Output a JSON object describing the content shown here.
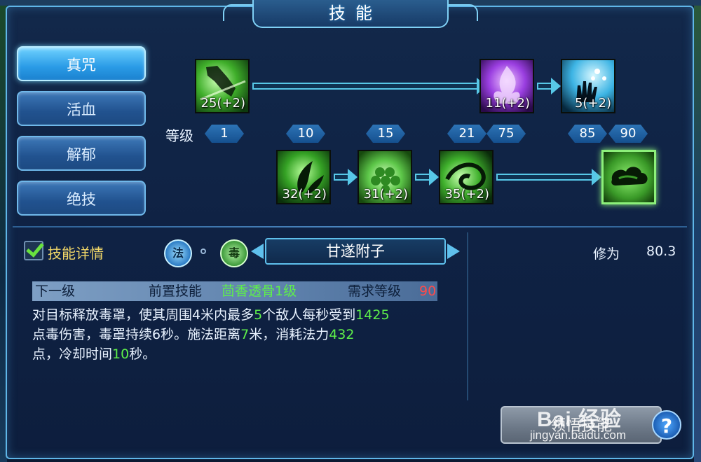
{
  "window": {
    "title": "技能"
  },
  "tabs": [
    {
      "label": "真咒",
      "active": true
    },
    {
      "label": "活血",
      "active": false
    },
    {
      "label": "解郁",
      "active": false
    },
    {
      "label": "绝技",
      "active": false
    }
  ],
  "tree": {
    "level_label": "等级",
    "levels": [
      "1",
      "10",
      "15",
      "21",
      "75",
      "85",
      "90"
    ],
    "nodes": [
      {
        "icon": "green-hand-skill-icon",
        "count": "25(+2)"
      },
      {
        "icon": "purple-flame-skill-icon",
        "count": "11(+2)"
      },
      {
        "icon": "cyan-hand-skill-icon",
        "count": "5(+2)"
      },
      {
        "icon": "green-leaf-skill-icon",
        "count": "32(+2)"
      },
      {
        "icon": "green-orbs-skill-icon",
        "count": "31(+2)"
      },
      {
        "icon": "green-swirl-skill-icon",
        "count": "35(+2)"
      },
      {
        "icon": "poison-cloud-skill-icon",
        "count": ""
      }
    ]
  },
  "detail": {
    "toggle_label": "技能详情",
    "checked": true,
    "school_badge": "法",
    "element_badge": "毒",
    "skill_name": "甘遂附子",
    "cultivation_label": "修为",
    "cultivation_value": "80.3",
    "requirements": {
      "next_label": "下一级",
      "prereq_label": "前置技能",
      "prereq_skill": "茴香透骨1级",
      "level_label": "需求等级",
      "level_value": "90"
    },
    "description": {
      "p1": "对目标释放毒罩，使其周围4米内最多",
      "v1": "5",
      "p2": "个敌人每秒受到",
      "v2": "1425",
      "p3": "点毒伤害，毒罩持续6秒。施法距离",
      "v3": "7",
      "p4": "米，消耗法力",
      "v4": "432",
      "p5": "点，冷却时间",
      "v5": "10",
      "p6": "秒。"
    }
  },
  "actions": {
    "learn_label": "领悟技能",
    "help_label": "?"
  },
  "watermark": {
    "brand": "Bai 经验",
    "url": "jingyan.baidu.com"
  },
  "colors": {
    "accent": "#5fc0ec",
    "highlight_green": "#5ef04a",
    "warning_red": "#ff4a4a",
    "gold": "#f1d768"
  }
}
